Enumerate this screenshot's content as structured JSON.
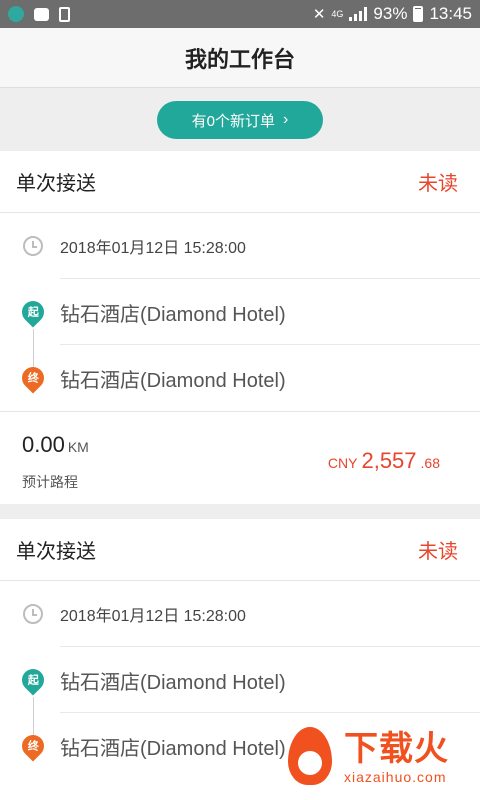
{
  "statusbar": {
    "network": "4G",
    "battery": "93%",
    "time": "13:45"
  },
  "header": {
    "title": "我的工作台"
  },
  "notice": {
    "label": "有0个新订单",
    "chevron": "›"
  },
  "orders": [
    {
      "type": "单次接送",
      "status": "未读",
      "time": "2018年01月12日 15:28:00",
      "start_marker": "起",
      "start": "钻石酒店(Diamond Hotel)",
      "end_marker": "终",
      "end": "钻石酒店(Diamond Hotel)",
      "distance": "0.00",
      "distance_unit": "KM",
      "distance_label": "预计路程",
      "currency": "CNY",
      "price_int": "2,557",
      "price_dec": ".68"
    },
    {
      "type": "单次接送",
      "status": "未读",
      "time": "2018年01月12日 15:28:00",
      "start_marker": "起",
      "start": "钻石酒店(Diamond Hotel)",
      "end_marker": "终",
      "end": "钻石酒店(Diamond Hotel)"
    }
  ],
  "watermark": {
    "cn": "下载火",
    "en": "xiazaihuo.com"
  },
  "colors": {
    "accent": "#22a89a",
    "status": "#e8452d",
    "end_pin": "#ec6a23"
  }
}
